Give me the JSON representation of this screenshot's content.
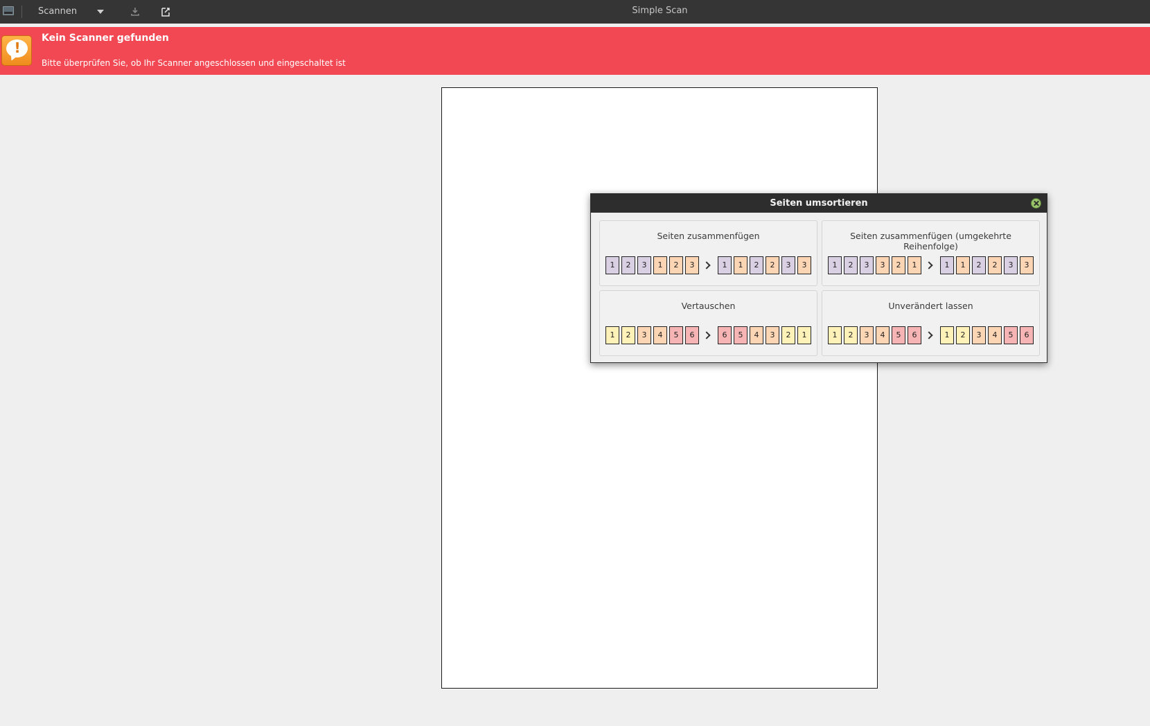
{
  "headerbar": {
    "scan_label": "Scannen",
    "title": "Simple Scan"
  },
  "infobar": {
    "title": "Kein Scanner gefunden",
    "message": "Bitte überprüfen Sie, ob Ihr Scanner angeschlossen und eingeschaltet ist"
  },
  "colors": {
    "infobar_bg": "#f24853",
    "headerbar_bg": "#353535",
    "page_purple": "#d9d0e3",
    "page_orange": "#fcd5b4",
    "page_yellow": "#fff2b8",
    "page_red": "#f7b4b4"
  },
  "dialog": {
    "title": "Seiten umsortieren",
    "options": [
      {
        "label": "Seiten zusammenfügen",
        "before": [
          [
            "1",
            "purple"
          ],
          [
            "2",
            "purple"
          ],
          [
            "3",
            "purple"
          ],
          [
            "1",
            "orange"
          ],
          [
            "2",
            "orange"
          ],
          [
            "3",
            "orange"
          ]
        ],
        "after": [
          [
            "1",
            "purple"
          ],
          [
            "1",
            "orange"
          ],
          [
            "2",
            "purple"
          ],
          [
            "2",
            "orange"
          ],
          [
            "3",
            "purple"
          ],
          [
            "3",
            "orange"
          ]
        ]
      },
      {
        "label": "Seiten zusammenfügen (umgekehrte Reihenfolge)",
        "before": [
          [
            "1",
            "purple"
          ],
          [
            "2",
            "purple"
          ],
          [
            "3",
            "purple"
          ],
          [
            "3",
            "orange"
          ],
          [
            "2",
            "orange"
          ],
          [
            "1",
            "orange"
          ]
        ],
        "after": [
          [
            "1",
            "purple"
          ],
          [
            "1",
            "orange"
          ],
          [
            "2",
            "purple"
          ],
          [
            "2",
            "orange"
          ],
          [
            "3",
            "purple"
          ],
          [
            "3",
            "orange"
          ]
        ]
      },
      {
        "label": "Vertauschen",
        "before": [
          [
            "1",
            "yellow"
          ],
          [
            "2",
            "yellow"
          ],
          [
            "3",
            "orange"
          ],
          [
            "4",
            "orange"
          ],
          [
            "5",
            "red"
          ],
          [
            "6",
            "red"
          ]
        ],
        "after": [
          [
            "6",
            "red"
          ],
          [
            "5",
            "red"
          ],
          [
            "4",
            "orange"
          ],
          [
            "3",
            "orange"
          ],
          [
            "2",
            "yellow"
          ],
          [
            "1",
            "yellow"
          ]
        ]
      },
      {
        "label": "Unverändert lassen",
        "before": [
          [
            "1",
            "yellow"
          ],
          [
            "2",
            "yellow"
          ],
          [
            "3",
            "orange"
          ],
          [
            "4",
            "orange"
          ],
          [
            "5",
            "red"
          ],
          [
            "6",
            "red"
          ]
        ],
        "after": [
          [
            "1",
            "yellow"
          ],
          [
            "2",
            "yellow"
          ],
          [
            "3",
            "orange"
          ],
          [
            "4",
            "orange"
          ],
          [
            "5",
            "red"
          ],
          [
            "6",
            "red"
          ]
        ]
      }
    ]
  }
}
